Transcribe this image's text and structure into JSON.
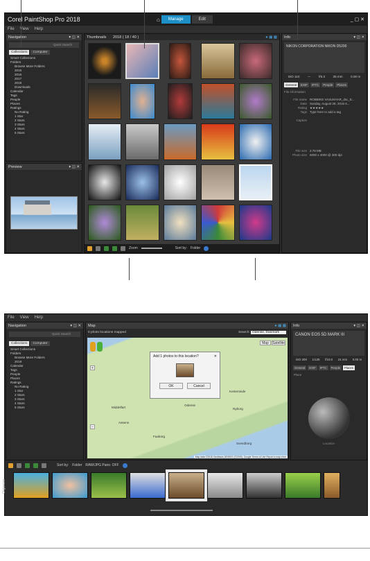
{
  "top": {
    "app_title": "Corel PaintShop Pro 2018",
    "menu": [
      "File",
      "View",
      "Help"
    ],
    "tabs": [
      "Manage",
      "Edit"
    ],
    "nav_title": "Navigation",
    "search_placeholder": "Quick Search",
    "collections_tab": "Collections",
    "computer_tab": "Computer",
    "tree": [
      "Smart Collections",
      "Folders",
      "Browse More Folders",
      "2015",
      "2016",
      "2017",
      "2018",
      "Downloads",
      "Calendar",
      "Tags",
      "People",
      "Places",
      "Ratings",
      "No Rating",
      "1 Star",
      "2 Stars",
      "3 Stars",
      "4 Stars",
      "5 Stars"
    ],
    "preview_title": "Preview",
    "thumbs_title": "Thumbnails",
    "thumbs_path": "2018 ( 18 / 40 )",
    "info_title": "Info",
    "camera": "NIKON CORPORATION NIKON D5200",
    "exif_values": [
      "ISO 110",
      "---",
      "f/6.3",
      "35 mm",
      "0.00 m"
    ],
    "info_tabs": [
      "General",
      "EXIF",
      "IPTC",
      "People",
      "Places"
    ],
    "file_info_label": "File information",
    "info_rows": [
      {
        "k": "File name",
        "v": "ROBBINS VASUKHAR_dsc_E..."
      },
      {
        "k": "Date",
        "v": "Sunday, August 28, 2016 6..."
      },
      {
        "k": "Rating",
        "v": "★★★★★"
      },
      {
        "k": "Tags",
        "v": "Type here to add a tag"
      },
      {
        "k": "Caption",
        "v": ""
      },
      {
        "k": "File size",
        "v": "2.78 MB"
      },
      {
        "k": "Photo size",
        "v": "6000 x 4000 @ 300 dpi"
      }
    ],
    "zoom_label": "Zoom",
    "sort_label": "Sort by:",
    "sort_value": "Folder"
  },
  "bottom": {
    "menu": [
      "File",
      "View",
      "Help"
    ],
    "nav_title": "Navigation",
    "search_placeholder": "Quick Search",
    "collections_tab": "Collections",
    "computer_tab": "Computer",
    "tree": [
      "Smart Collections",
      "Folders",
      "Browse More Folders",
      "2018",
      "Calendar",
      "Tags",
      "People",
      "Places",
      "Ratings",
      "No Rating",
      "1 Star",
      "2 Stars",
      "3 Stars",
      "4 Stars",
      "5 Stars"
    ],
    "map_title": "Map",
    "mapped_text": "0 photo locations mapped",
    "search_label": "Search:",
    "search_value": "Odense, Danmark",
    "map_btn": "Map",
    "sat_btn": "Satellite",
    "dialog_title": "Add 1 photos to this location?",
    "ok": "OK",
    "cancel": "Cancel",
    "cities": [
      "Odense",
      "Svendborg",
      "Nyborg",
      "Bogense",
      "Middelfart",
      "Faaborg",
      "Assens",
      "Kerteminde"
    ],
    "map_footer": "Map data ©2018 GeoBasis-DE/BKG (©2009), Google   Terms of Use   Report a map error",
    "info_title": "Info",
    "camera": "CANON EOS 5D MARK III",
    "exif_values": [
      "ISO 200",
      "1/125",
      "f/10.0",
      "24 mm",
      "0.00 m"
    ],
    "info_tabs": [
      "General",
      "EXIF",
      "IPTC",
      "People",
      "Places"
    ],
    "place_label": "Place",
    "location_label": "Location",
    "sort_label": "Sort by:",
    "sort_value": "Folder",
    "raw_label": "RAW/JPG Pairs: OFF",
    "organizer_label": "Organizer"
  }
}
